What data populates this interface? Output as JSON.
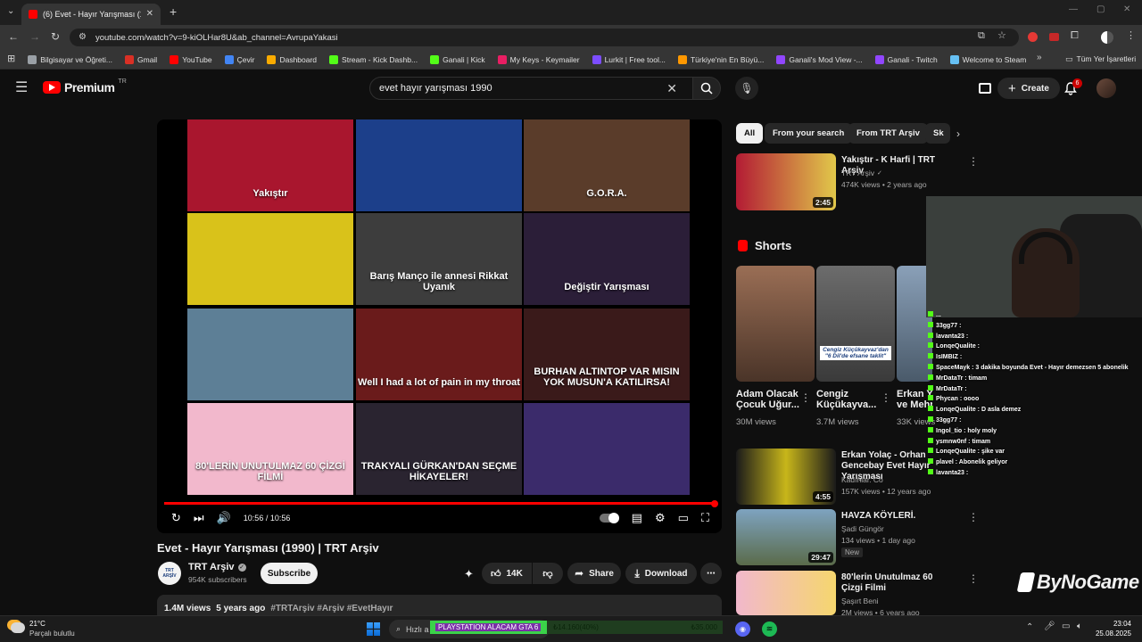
{
  "browser": {
    "tab_title": "(6) Evet - Hayır Yarışması (1990) | TRT Arşiv",
    "tab_count_badge": "6",
    "url": "youtube.com/watch?v=9-kiOLHar8U&ab_channel=AvrupaYakasi",
    "bookmarks": [
      {
        "label": "Bilgisayar ve Öğreti...",
        "color": "#9aa0a6"
      },
      {
        "label": "Gmail",
        "color": "#d93025"
      },
      {
        "label": "YouTube",
        "color": "#ff0000"
      },
      {
        "label": "Çevir",
        "color": "#4285f4"
      },
      {
        "label": "Dashboard",
        "color": "#f9ab00"
      },
      {
        "label": "Stream - Kick Dashb...",
        "color": "#53fc18"
      },
      {
        "label": "Ganali | Kick",
        "color": "#53fc18"
      },
      {
        "label": "My Keys - Keymailer",
        "color": "#e91e63"
      },
      {
        "label": "Lurkit | Free tool...",
        "color": "#7c4dff"
      },
      {
        "label": "Türkiye'nin En Büyü...",
        "color": "#ff9800"
      },
      {
        "label": "Ganali's Mod View -...",
        "color": "#9146ff"
      },
      {
        "label": "Ganali - Twitch",
        "color": "#9146ff"
      },
      {
        "label": "Welcome to Steam",
        "color": "#66c0f4"
      }
    ],
    "all_bookmarks": "Tüm Yer İşaretleri"
  },
  "youtube": {
    "logo_text": "Premium",
    "region": "TR",
    "search_query": "evet hayır yarışması 1990",
    "create_label": "Create",
    "notif_count": "6"
  },
  "video": {
    "endscreen": [
      {
        "caption": "Yakıştır",
        "bg": "#a9162e"
      },
      {
        "caption": "",
        "bg": "#1c3f8a"
      },
      {
        "caption": "G.O.R.A.",
        "bg": "#5a3c2a"
      },
      {
        "caption": "",
        "bg": "#d9c21a"
      },
      {
        "caption": "Barış Manço ile annesi Rikkat Uyanık",
        "bg": "#3d3d3d"
      },
      {
        "caption": "Değiştir Yarışması",
        "bg": "#2b1e38"
      },
      {
        "caption": "",
        "bg": "#5d7f96"
      },
      {
        "caption": "Well I had a lot of pain in my throat",
        "bg": "#6a1b1b"
      },
      {
        "caption": "BURHAN ALTINTOP VAR MISIN YOK MUSUN'A KATILIRSA!",
        "bg": "#3a1a1a"
      },
      {
        "caption": "80'LERİN UNUTULMAZ 60 ÇİZGİ FİLMİ",
        "bg": "#f2b8cc"
      },
      {
        "caption": "TRAKYALI GÜRKAN'DAN SEÇME HİKAYELER!",
        "bg": "#2a2430"
      },
      {
        "caption": "",
        "bg": "#3b2b6b"
      }
    ],
    "time": "10:56 / 10:56",
    "title": "Evet - Hayır Yarışması (1990) | TRT Arşiv",
    "channel": "TRT Arşiv",
    "channel_avatar": "TRT ARŞİV",
    "subscribers": "954K subscribers",
    "subscribe": "Subscribe",
    "likes": "14K",
    "share": "Share",
    "download": "Download",
    "description": {
      "views": "1.4M views",
      "ago": "5 years ago",
      "tags": "#TRTArşiv #Arşiv #EvetHayır"
    }
  },
  "sidebar": {
    "chips": [
      "All",
      "From your search",
      "From TRT Arşiv",
      "Sk"
    ],
    "first": {
      "title": "Yakıştır - K Harfi | TRT Arşiv",
      "channel": "TRT Arşiv",
      "meta": "474K views • 2 years ago",
      "duration": "2:45"
    },
    "shorts_label": "Shorts",
    "shorts": [
      {
        "title1": "Adam Olacak",
        "title2": "Çocuk Uğur...",
        "views": "30M views",
        "bg": "#7d5a4a"
      },
      {
        "title1": "Cengiz",
        "title2": "Küçükayva...",
        "views": "3.7M views",
        "bg": "#5a5c5e",
        "overlay": "Cengiz Küçükayvaz'dan \"6 Dil'de efsane taklit\""
      },
      {
        "title1": "Erkan Yolaç",
        "title2": "ve Mehpare",
        "views": "33K views",
        "bg": "#6e7e91"
      }
    ],
    "items": [
      {
        "title": "Erkan Yolaç - Orhan Gencebay Evet Hayır Yarışması",
        "channel": "Kadınlar. Co",
        "meta": "157K views • 12 years ago",
        "duration": "4:55",
        "bg": "#c8b61a"
      },
      {
        "title": "HAVZA KÖYLERİ.",
        "channel": "Şadi Güngör",
        "meta": "134 views • 1 day ago",
        "badge": "New",
        "duration": "29:47",
        "bg": "#6f8ea3"
      },
      {
        "title": "80'lerin Unutulmaz 60 Çizgi Filmi",
        "channel": "Şaşırt Beni",
        "meta": "2M views • 6 years ago",
        "duration": "",
        "bg": "#f2b8cc"
      }
    ]
  },
  "overlay": {
    "chat": [
      "...",
      "33gg77 :",
      "lavanta23 :",
      "LonqeQualite :",
      "IsIMBIZ :",
      "SpaceMayk : 3 dakika boyunda Evet - Hayır demezsen 5 abonelik",
      "MrDataTr : timam",
      "MrDataTr :",
      "Phycan : oooo",
      "LonqeQualite : D asla demez",
      "33gg77 :",
      "Ingol_tio : holy moly",
      "ysmnw0nf : timam",
      "LonqeQualite : şike var",
      "plavel : Abonelik geliyor",
      "lavanta23 :"
    ],
    "brand": "ByNoGame"
  },
  "taskbar": {
    "temp": "21°C",
    "weather": "Parçalı bulutlu",
    "search_placeholder": "Hızlı a",
    "donation_goal": "PLAYSTATION ALACAM GTA 6",
    "goal_progress": "₺14.160(40%)",
    "goal_progress_fraction": 0.4,
    "goal_target": "₺35.000",
    "time": "23:04",
    "date": "25.08.2025"
  },
  "colors": {
    "accent": "#ff0000",
    "kick": "#53fc18",
    "chip_active": "#f1f1f1"
  }
}
